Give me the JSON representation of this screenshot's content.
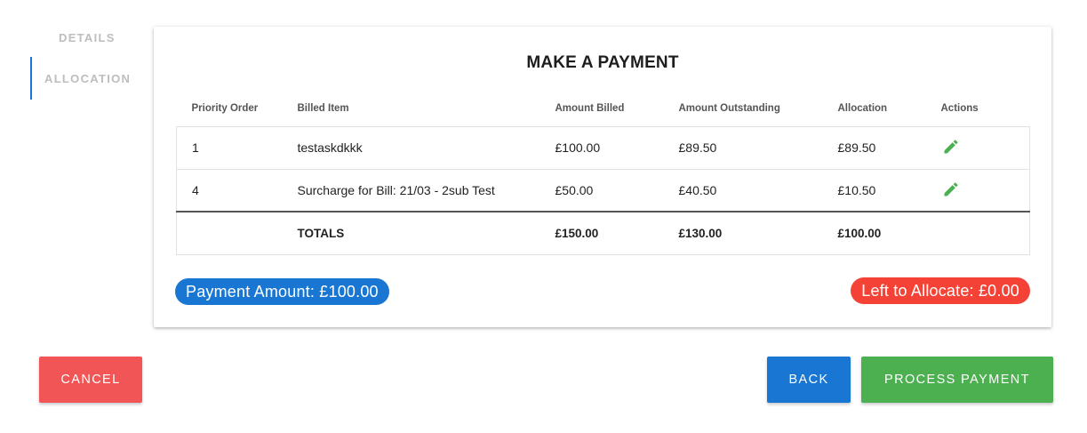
{
  "side_nav": {
    "items": [
      {
        "label": "DETAILS"
      },
      {
        "label": "ALLOCATION"
      }
    ]
  },
  "card": {
    "title": "MAKE A PAYMENT",
    "columns": [
      "Priority Order",
      "Billed Item",
      "Amount Billed",
      "Amount Outstanding",
      "Allocation",
      "Actions"
    ],
    "rows": [
      {
        "priority": "1",
        "item": "testaskdkkk",
        "billed": "£100.00",
        "outstanding": "£89.50",
        "allocation": "£89.50",
        "action_icon": "pencil-icon"
      },
      {
        "priority": "4",
        "item": "Surcharge for Bill: 21/03 - 2sub Test",
        "billed": "£50.00",
        "outstanding": "£40.50",
        "allocation": "£10.50",
        "action_icon": "pencil-icon"
      }
    ],
    "totals": {
      "label": "TOTALS",
      "billed": "£150.00",
      "outstanding": "£130.00",
      "allocation": "£100.00"
    },
    "payment_amount": "Payment Amount: £100.00",
    "left_to_allocate": "Left to Allocate: £0.00"
  },
  "buttons": {
    "cancel": "CANCEL",
    "back": "BACK",
    "process": "PROCESS PAYMENT"
  },
  "colors": {
    "primary": "#1976d2",
    "danger": "#f44336",
    "cancel": "#f25555",
    "success": "#4caf50",
    "edit_icon": "#4caf50"
  }
}
